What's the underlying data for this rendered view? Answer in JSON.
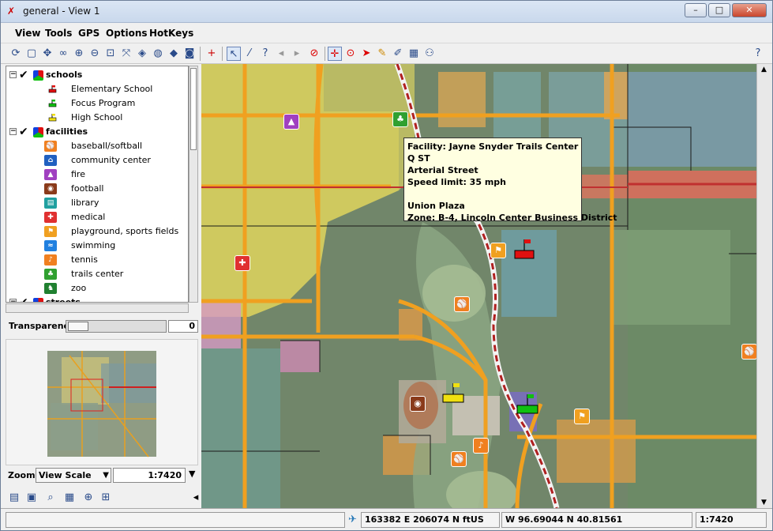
{
  "window": {
    "title": "general - View 1",
    "minimize": "–",
    "maximize": "□",
    "close": "✕"
  },
  "menu": [
    "View",
    "Tools",
    "GPS",
    "Options",
    "HotKeys"
  ],
  "legend": {
    "groups": [
      {
        "name": "schools",
        "items": [
          {
            "label": "Elementary School",
            "color": "#e01010"
          },
          {
            "label": "Focus Program",
            "color": "#10c010"
          },
          {
            "label": "High School",
            "color": "#f0e010"
          }
        ]
      },
      {
        "name": "facilities",
        "items": [
          {
            "label": "baseball/softball",
            "color": "#f08020",
            "icon": "baseball-icon"
          },
          {
            "label": "community center",
            "color": "#2060c0",
            "icon": "community-icon"
          },
          {
            "label": "fire",
            "color": "#a040c0",
            "icon": "fire-icon"
          },
          {
            "label": "football",
            "color": "#8a3a1a",
            "icon": "football-icon"
          },
          {
            "label": "library",
            "color": "#20a0a0",
            "icon": "library-icon"
          },
          {
            "label": "medical",
            "color": "#e03030",
            "icon": "medical-icon"
          },
          {
            "label": "playground, sports fields",
            "color": "#f0a020",
            "icon": "playground-icon"
          },
          {
            "label": "swimming",
            "color": "#2080e0",
            "icon": "swimming-icon"
          },
          {
            "label": "tennis",
            "color": "#f08020",
            "icon": "tennis-icon"
          },
          {
            "label": "trails center",
            "color": "#30a030",
            "icon": "trails-icon"
          },
          {
            "label": "zoo",
            "color": "#208030",
            "icon": "zoo-icon"
          }
        ]
      },
      {
        "name": "streets",
        "items": []
      }
    ]
  },
  "transparency": {
    "label": "Transparency",
    "value": "0"
  },
  "zoom": {
    "label": "Zoom",
    "mode": "View Scale",
    "scale": "1:7420"
  },
  "tooltip": {
    "lines": [
      "Facility: Jayne Snyder Trails Center",
      "Q ST",
      "Arterial Street",
      "Speed limit: 35 mph",
      "",
      "Union Plaza",
      "Zone: B-4, Lincoln Center Business District"
    ]
  },
  "status": {
    "projected": "163382 E  206074 N ftUS",
    "geographic": "W 96.69044  N 40.81561",
    "scale": "1:7420"
  },
  "help": "?"
}
